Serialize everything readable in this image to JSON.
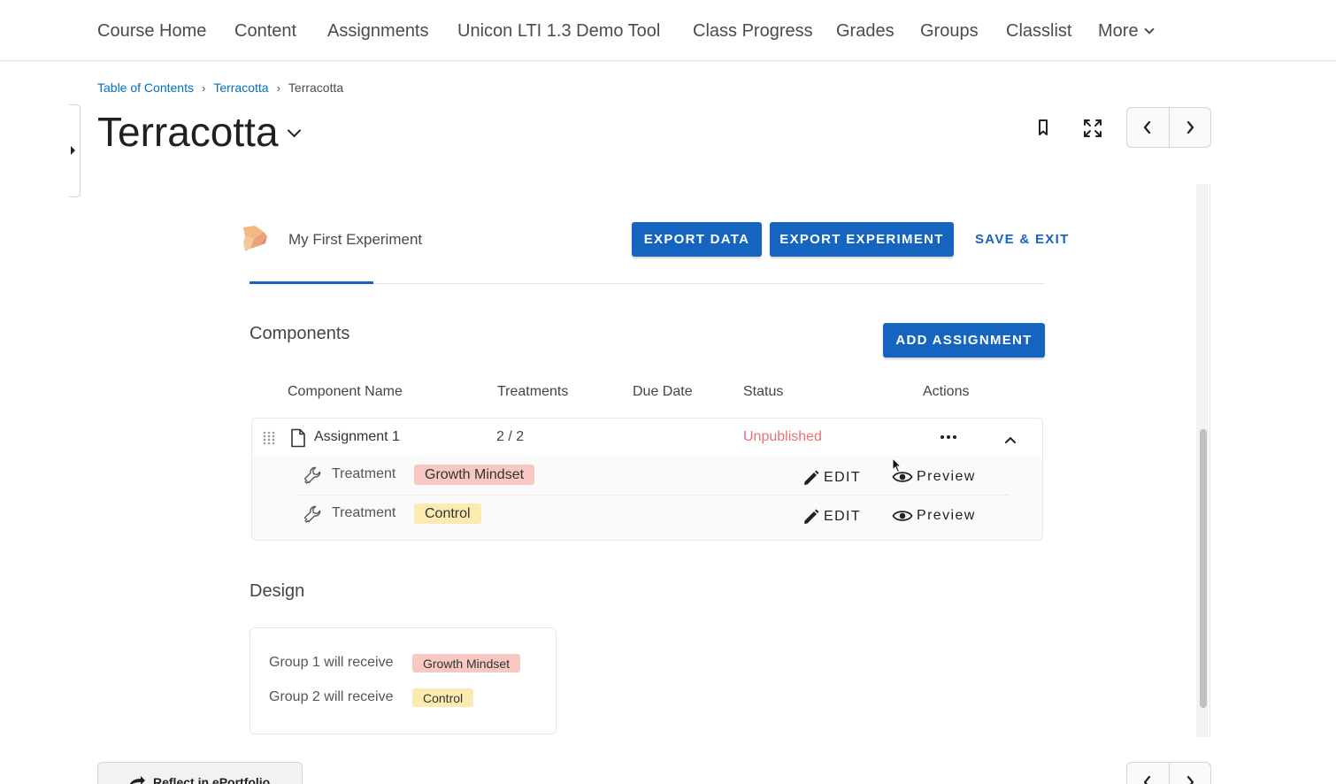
{
  "nav": {
    "items": [
      "Course Home",
      "Content",
      "Assignments",
      "Unicon LTI 1.3 Demo Tool",
      "Class Progress",
      "Grades",
      "Groups",
      "Classlist"
    ],
    "more_label": "More"
  },
  "breadcrumb": {
    "items": [
      "Table of Contents",
      "Terracotta"
    ],
    "current": "Terracotta"
  },
  "page": {
    "title": "Terracotta"
  },
  "experiment": {
    "name": "My First Experiment",
    "export_data_label": "EXPORT DATA",
    "export_experiment_label": "EXPORT EXPERIMENT",
    "save_exit_label": "SAVE & EXIT"
  },
  "components": {
    "title": "Components",
    "add_label": "ADD ASSIGNMENT",
    "headers": [
      "Component Name",
      "Treatments",
      "Due Date",
      "Status",
      "Actions"
    ],
    "assignment": {
      "name": "Assignment 1",
      "treatments": "2 / 2",
      "status": "Unpublished",
      "status_color": "#e57373"
    },
    "treatment_rows": [
      {
        "label": "Treatment",
        "tag": "Growth Mindset",
        "tag_color": "#f8c9c2",
        "edit_label": "EDIT",
        "preview_label": "Preview"
      },
      {
        "label": "Treatment",
        "tag": "Control",
        "tag_color": "#fcebb0",
        "edit_label": "EDIT",
        "preview_label": "Preview"
      }
    ]
  },
  "design": {
    "title": "Design",
    "groups": [
      {
        "text": "Group 1 will receive",
        "tag": "Growth Mindset"
      },
      {
        "text": "Group 2 will receive",
        "tag": "Control"
      }
    ]
  },
  "footer": {
    "reflect_label": "Reflect in ePortfolio"
  },
  "colors": {
    "accent": "#1565c0",
    "link": "#006fbf"
  }
}
